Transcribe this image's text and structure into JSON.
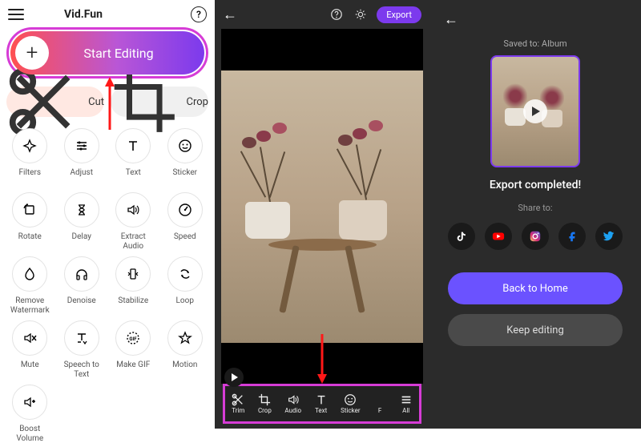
{
  "home": {
    "app_name": "Vid.Fun",
    "start_label": "Start Editing",
    "cut_label": "Cut",
    "crop_label": "Crop",
    "tools": [
      {
        "label": "Filters",
        "icon": "sparkle"
      },
      {
        "label": "Adjust",
        "icon": "sliders"
      },
      {
        "label": "Text",
        "icon": "text"
      },
      {
        "label": "Sticker",
        "icon": "smiley"
      },
      {
        "label": "Rotate",
        "icon": "rotate"
      },
      {
        "label": "Delay",
        "icon": "hourglass"
      },
      {
        "label": "Extract Audio",
        "icon": "audio"
      },
      {
        "label": "Speed",
        "icon": "gauge"
      },
      {
        "label": "Remove Watermark",
        "icon": "drop"
      },
      {
        "label": "Denoise",
        "icon": "headphones"
      },
      {
        "label": "Stabilize",
        "icon": "stabilize"
      },
      {
        "label": "Loop",
        "icon": "loop"
      },
      {
        "label": "Mute",
        "icon": "mute"
      },
      {
        "label": "Speech to Text",
        "icon": "speechtext"
      },
      {
        "label": "Make GIF",
        "icon": "gif"
      },
      {
        "label": "Motion",
        "icon": "star"
      },
      {
        "label": "Boost Volume",
        "icon": "volume"
      }
    ]
  },
  "editor": {
    "export_label": "Export",
    "toolbar": [
      {
        "label": "Trim",
        "icon": "scissors"
      },
      {
        "label": "Crop",
        "icon": "crop"
      },
      {
        "label": "Audio",
        "icon": "audio"
      },
      {
        "label": "Text",
        "icon": "text"
      },
      {
        "label": "Sticker",
        "icon": "smiley"
      },
      {
        "label": "F",
        "icon": "blank"
      },
      {
        "label": "All",
        "icon": "menu"
      }
    ]
  },
  "export": {
    "saved_to": "Saved to: Album",
    "status": "Export completed!",
    "share_to": "Share to:",
    "shares": [
      "tiktok",
      "youtube",
      "instagram",
      "facebook",
      "twitter"
    ],
    "back_home": "Back to Home",
    "keep_editing": "Keep editing"
  }
}
